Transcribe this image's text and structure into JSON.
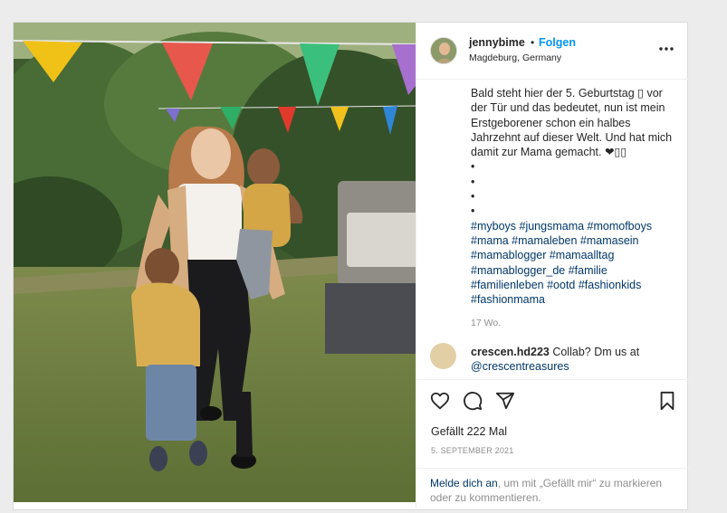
{
  "header": {
    "username": "jennybime",
    "separator": "•",
    "follow_label": "Folgen",
    "location": "Magdeburg, Germany",
    "more_label": "•••"
  },
  "caption": {
    "line1": "Bald steht hier der 5. Geburtstag ▯ vor",
    "line2": "der Tür und das bedeutet, nun ist mein",
    "line3": "Erstgeborener schon ein halbes",
    "line4": "Jahrzehnt auf dieser Welt. Und hat mich",
    "line5": "damit zur Mama gemacht. ❤▯▯",
    "bullet": "•",
    "tags1": "#myboys #jungsmama #momofboys",
    "tags2": "#mama #mamaleben #mamasein",
    "tags3": "#mamablogger #mamaalltag",
    "tags4": "#mamablogger_de #familie",
    "tags5": "#familienleben #ootd #fashionkids",
    "tags6": "#fashionmama",
    "age": "17 Wo."
  },
  "comment": {
    "username": "crescen.hd223",
    "text": " Collab? Dm us at",
    "mention": "@crescentreasures"
  },
  "post": {
    "likes": "Gefällt 222 Mal",
    "date": "5. SEPTEMBER 2021"
  },
  "login_prompt": {
    "link": "Melde dich an",
    "rest1": ", um mit „Gefällt mir“ zu markieren",
    "rest2": "oder zu kommentieren."
  },
  "icons": {
    "like": "heart-icon",
    "comment": "comment-icon",
    "share": "share-icon",
    "save": "bookmark-icon",
    "more": "more-icon"
  },
  "colors": {
    "follow": "#0095f6",
    "hashtag": "#00376b",
    "muted": "#8e8e8e"
  }
}
